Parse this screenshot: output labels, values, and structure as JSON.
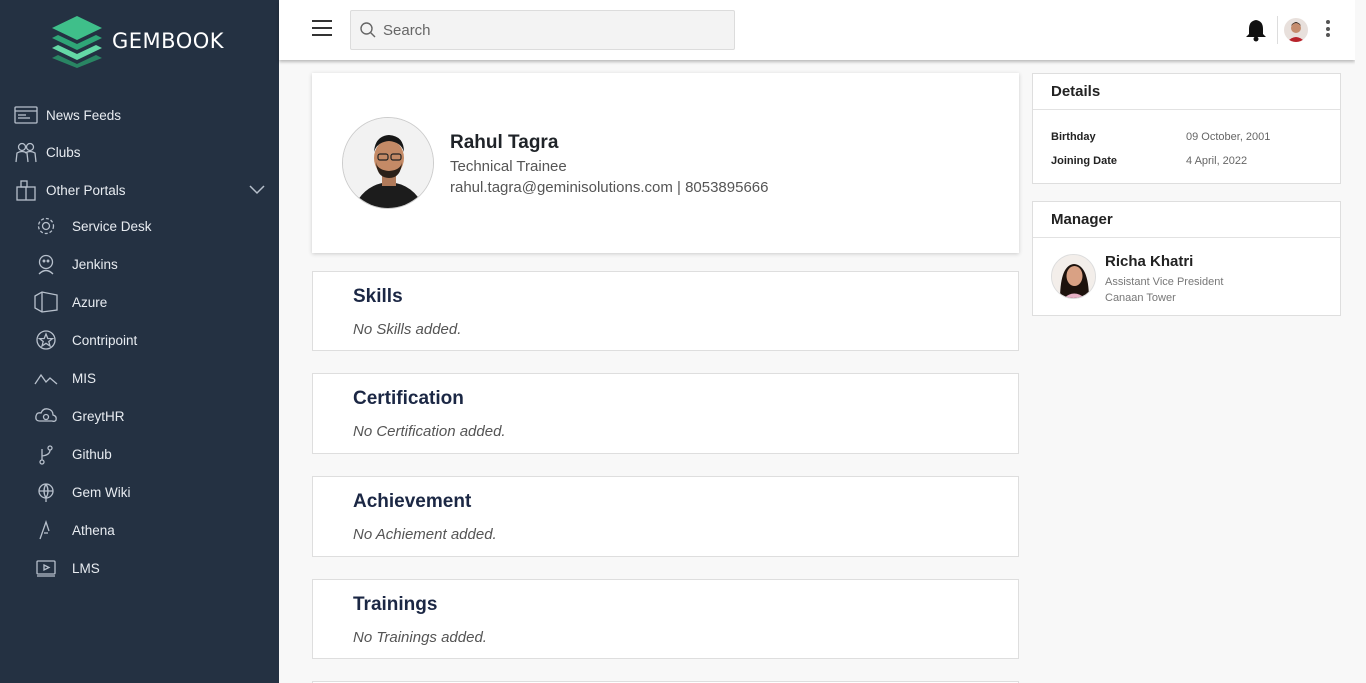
{
  "brand": {
    "name": "GEMBOOK"
  },
  "sidebar": {
    "items": [
      {
        "label": "News Feeds",
        "icon": "news-feed-icon"
      },
      {
        "label": "Clubs",
        "icon": "clubs-icon"
      },
      {
        "label": "Other Portals",
        "icon": "portals-icon"
      }
    ],
    "portals": [
      {
        "label": "Service Desk",
        "icon": "gear-icon"
      },
      {
        "label": "Jenkins",
        "icon": "jenkins-icon"
      },
      {
        "label": "Azure",
        "icon": "azure-icon"
      },
      {
        "label": "Contripoint",
        "icon": "star-badge-icon"
      },
      {
        "label": "MIS",
        "icon": "mountain-icon"
      },
      {
        "label": "GreytHR",
        "icon": "cloud-icon"
      },
      {
        "label": "Github",
        "icon": "branch-icon"
      },
      {
        "label": "Gem Wiki",
        "icon": "globe-icon"
      },
      {
        "label": "Athena",
        "icon": "triangle-icon"
      },
      {
        "label": "LMS",
        "icon": "video-icon"
      }
    ]
  },
  "topbar": {
    "search_placeholder": "Search"
  },
  "profile": {
    "name": "Rahul Tagra",
    "role": "Technical Trainee",
    "contact": "rahul.tagra@geminisolutions.com | 8053895666"
  },
  "sections": [
    {
      "title": "Skills",
      "empty": "No Skills added."
    },
    {
      "title": "Certification",
      "empty": "No Certification added."
    },
    {
      "title": "Achievement",
      "empty": "No Achiement added."
    },
    {
      "title": "Trainings",
      "empty": "No Trainings added."
    }
  ],
  "details": {
    "header": "Details",
    "rows": [
      {
        "label": "Birthday",
        "value": "09 October, 2001"
      },
      {
        "label": "Joining Date",
        "value": "4 April, 2022"
      }
    ]
  },
  "manager": {
    "header": "Manager",
    "name": "Richa Khatri",
    "title": "Assistant Vice President",
    "location": "Canaan Tower"
  },
  "colors": {
    "sidebar_bg": "#243142",
    "brand_green": "#3fbf8a",
    "heading_navy": "#1b2744"
  }
}
